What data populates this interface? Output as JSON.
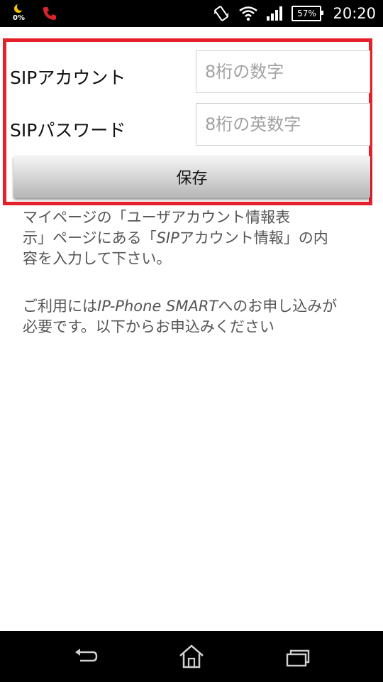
{
  "status_bar": {
    "night_mode_percent": "0%",
    "battery_percent": "57%",
    "time": "20:20",
    "icons": [
      "moon-icon",
      "missed-call-icon",
      "vibrate-icon",
      "wifi-icon",
      "signal-icon",
      "battery-icon"
    ],
    "colors": {
      "background": "#000000",
      "moon": "#f5c400",
      "missed_call": "#d9232e"
    }
  },
  "form": {
    "highlight_color": "#e4202b",
    "account_label": "SIPアカウント",
    "account_placeholder": "8桁の数字",
    "password_label": "SIPパスワード",
    "password_placeholder": "8桁の英数字",
    "save_label": "保存"
  },
  "description": {
    "line1": "マイページの「ユーザアカウント情報表",
    "line2a": "示」ページにある「",
    "line2b": "SIP",
    "line2c": "アカウント情報」の内",
    "line3": "容を入力して下さい。",
    "line4a": "ご利用には",
    "line4b": "IP-Phone SMART",
    "line4c": "へのお申し込みが",
    "line5": "必要です。以下からお申込みください"
  },
  "nav_bar": {
    "icons": [
      "back-icon",
      "home-icon",
      "recent-apps-icon"
    ]
  }
}
